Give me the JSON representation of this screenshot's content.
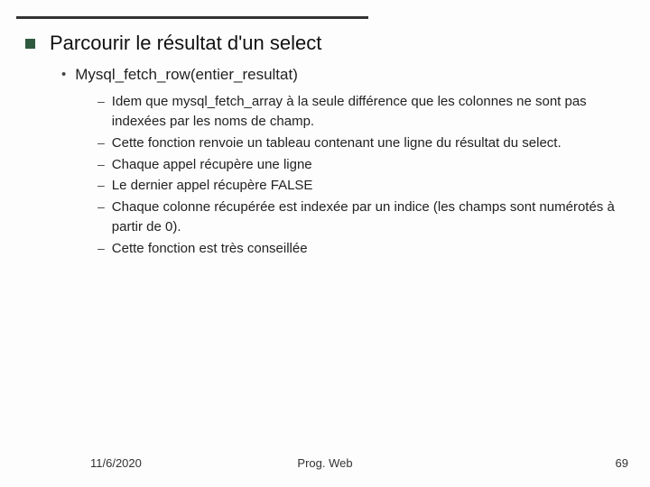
{
  "title": "Parcourir le résultat d'un select",
  "subitem": "Mysql_fetch_row(entier_resultat)",
  "points": [
    "Idem que mysql_fetch_array à la seule différence que les colonnes ne sont pas indexées par les noms de champ.",
    "Cette fonction renvoie un tableau contenant une ligne du résultat du select.",
    "Chaque appel récupère une ligne",
    "Le dernier appel récupère FALSE",
    "Chaque colonne récupérée est indexée par un indice (les champs sont numérotés à partir de 0).",
    "Cette fonction est très conseillée"
  ],
  "footer": {
    "date": "11/6/2020",
    "title": "Prog. Web",
    "page": "69"
  }
}
